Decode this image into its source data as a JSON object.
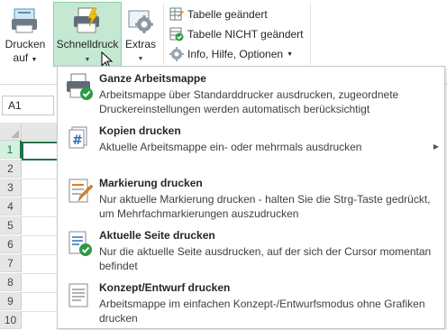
{
  "ribbon": {
    "drucken": {
      "line1": "Drucken",
      "line2": "auf"
    },
    "schnelldruck": {
      "label": "Schnelldruck"
    },
    "extras": {
      "label": "Extras"
    },
    "small": [
      {
        "label": "Tabelle geändert",
        "icon": "table-changed-icon"
      },
      {
        "label": "Tabelle NICHT geändert",
        "icon": "table-unchanged-icon"
      },
      {
        "label": "Info, Hilfe, Optionen",
        "icon": "gear-info-icon"
      }
    ]
  },
  "namebox": {
    "value": "A1"
  },
  "sheet": {
    "rows": [
      "1",
      "2",
      "3",
      "4",
      "5",
      "6",
      "7",
      "8",
      "9",
      "10"
    ]
  },
  "menu": {
    "items": [
      {
        "title": "Ganze Arbeitsmappe",
        "desc": "Arbeitsmappe über Standarddrucker ausdrucken, zugeordnete Druckereinstellungen werden automatisch berücksichtigt",
        "icon": "printer-check-icon"
      },
      {
        "title": "Kopien drucken",
        "desc": "Aktuelle Arbeitsmappe ein- oder mehrmals ausdrucken",
        "icon": "copies-hash-icon"
      },
      {
        "title": "Markierung drucken",
        "desc": "Nur aktuelle Markierung drucken - halten Sie die Strg-Taste gedrückt, um Mehrfachmarkierungen auszudrucken",
        "icon": "selection-pencil-icon"
      },
      {
        "title": "Aktuelle Seite drucken",
        "desc": "Nur die aktuelle Seite ausdrucken, auf der sich der Cursor momentan befindet",
        "icon": "page-check-icon"
      },
      {
        "title": "Konzept/Entwurf drucken",
        "desc": "Arbeitsmappe im einfachen Konzept-/Entwurfsmodus ohne Grafiken drucken",
        "icon": "draft-document-icon"
      }
    ]
  },
  "colors": {
    "accent": "#217346",
    "highlight": "#c5e8d2"
  }
}
